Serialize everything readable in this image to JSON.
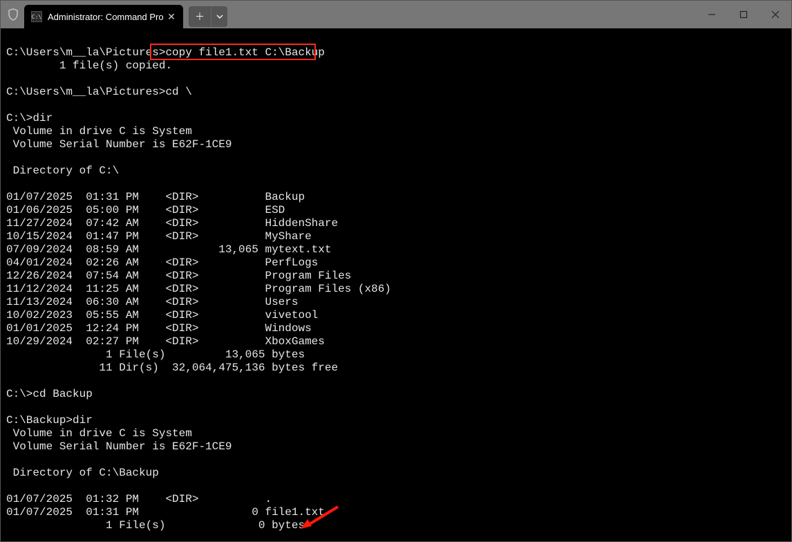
{
  "window": {
    "tab_title": "Administrator: Command Pro"
  },
  "highlight_command": "copy file1.txt C:\\Backup",
  "terminal_lines": [
    "C:\\Users\\m__la\\Pictures>copy file1.txt C:\\Backup",
    "        1 file(s) copied.",
    "",
    "C:\\Users\\m__la\\Pictures>cd \\",
    "",
    "C:\\>dir",
    " Volume in drive C is System",
    " Volume Serial Number is E62F-1CE9",
    "",
    " Directory of C:\\",
    "",
    "01/07/2025  01:31 PM    <DIR>          Backup",
    "01/06/2025  05:00 PM    <DIR>          ESD",
    "11/27/2024  07:42 AM    <DIR>          HiddenShare",
    "10/15/2024  01:47 PM    <DIR>          MyShare",
    "07/09/2024  08:59 AM            13,065 mytext.txt",
    "04/01/2024  02:26 AM    <DIR>          PerfLogs",
    "12/26/2024  07:54 AM    <DIR>          Program Files",
    "11/12/2024  11:25 AM    <DIR>          Program Files (x86)",
    "11/13/2024  06:30 AM    <DIR>          Users",
    "10/02/2023  05:55 AM    <DIR>          vivetool",
    "01/01/2025  12:24 PM    <DIR>          Windows",
    "10/29/2024  02:27 PM    <DIR>          XboxGames",
    "               1 File(s)         13,065 bytes",
    "              11 Dir(s)  32,064,475,136 bytes free",
    "",
    "C:\\>cd Backup",
    "",
    "C:\\Backup>dir",
    " Volume in drive C is System",
    " Volume Serial Number is E62F-1CE9",
    "",
    " Directory of C:\\Backup",
    "",
    "01/07/2025  01:32 PM    <DIR>          .",
    "01/07/2025  01:31 PM                 0 file1.txt",
    "               1 File(s)              0 bytes"
  ]
}
